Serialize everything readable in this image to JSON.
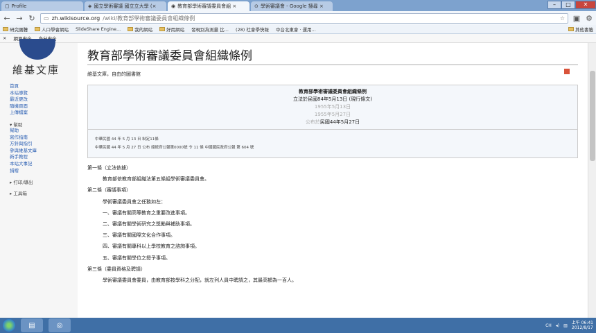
{
  "tabs": [
    {
      "label": "Profile",
      "icon": "profile-icon"
    },
    {
      "label": "國立學術審議 國立立大學 (×",
      "icon": "page-icon"
    },
    {
      "label": "教育部學術審議委員會組 ×",
      "icon": "wiki-icon"
    },
    {
      "label": "學術審議會 - Google 搜尋 ×",
      "icon": "search-icon"
    }
  ],
  "url": {
    "domain": "zh.wikisource.org",
    "path": "/wiki/教育部學術審議委員會組織條例"
  },
  "bookmarks": [
    "研究團體",
    "人口學會網站",
    "SlideShare Engine...",
    "我的網站",
    "好用網站",
    "發現別為測量 比...",
    "(28) 社會學快報",
    "中台北東會 · 運用...",
    "其他書籤"
  ],
  "extensions": [
    "網頁安全",
    "身分安全"
  ],
  "sidebar": {
    "logo_text": "維基文庫",
    "nav": [
      "首頁",
      "本站導覽",
      "最近更改",
      "隨機頁面",
      "上傳檔案"
    ],
    "help_header": "▾ 幫助",
    "help_items": [
      "幫助",
      "寫作指南",
      "方針與指引",
      "參與維基文庫",
      "新手教程",
      "本站大事記",
      "捐贈"
    ],
    "print_export": "▸ 打印/導出",
    "tools": "▸ 工具箱"
  },
  "page": {
    "title": "教育部學術審議委員會組織條例",
    "subtitle": "維基文庫，自由的圖書館",
    "header": {
      "heading": "教育部學術審議委員會組織條例",
      "line1": "立法於民國84年5月13日 (現行條文)",
      "line2": "1955年5月13日",
      "line3": "1955年5月27日",
      "line4_prefix": "公布於",
      "line4": "民國44年5月27日"
    },
    "notes": [
      "中華民國 44 年 5 月 13 日 制定11條",
      "中華民國 44 年 5 月 27 日 公布 總統府公報第0000號 令 11 條 中國國民政府公報 第 604 號"
    ],
    "articles": [
      {
        "heading": "第一條（立法依據）",
        "lines": [
          "教育部依教育部組織法第五條組學術審議委員會。"
        ]
      },
      {
        "heading": "第二條（審議事項）",
        "lines": [
          "學術審議委員會之任務如左：",
          "一、審議有關高等教育之重要改進事項。",
          "二、審議有關學術研究之獎勵與補助事項。",
          "三、審議有關國際文化合作事項。",
          "四、審議有關專科以上學校教育之諮詢事項。",
          "五、審議有關學位之授予事項。"
        ]
      },
      {
        "heading": "第三條（委員資格及聘請）",
        "lines": [
          "學術審議委員會委員，由教育部按學科之分配，就左列人員中聘請之，其最高額為一百人。"
        ]
      }
    ]
  },
  "taskbar": {
    "tray_text": "CH",
    "time": "上午 06:41",
    "date": "2012/8/17"
  }
}
